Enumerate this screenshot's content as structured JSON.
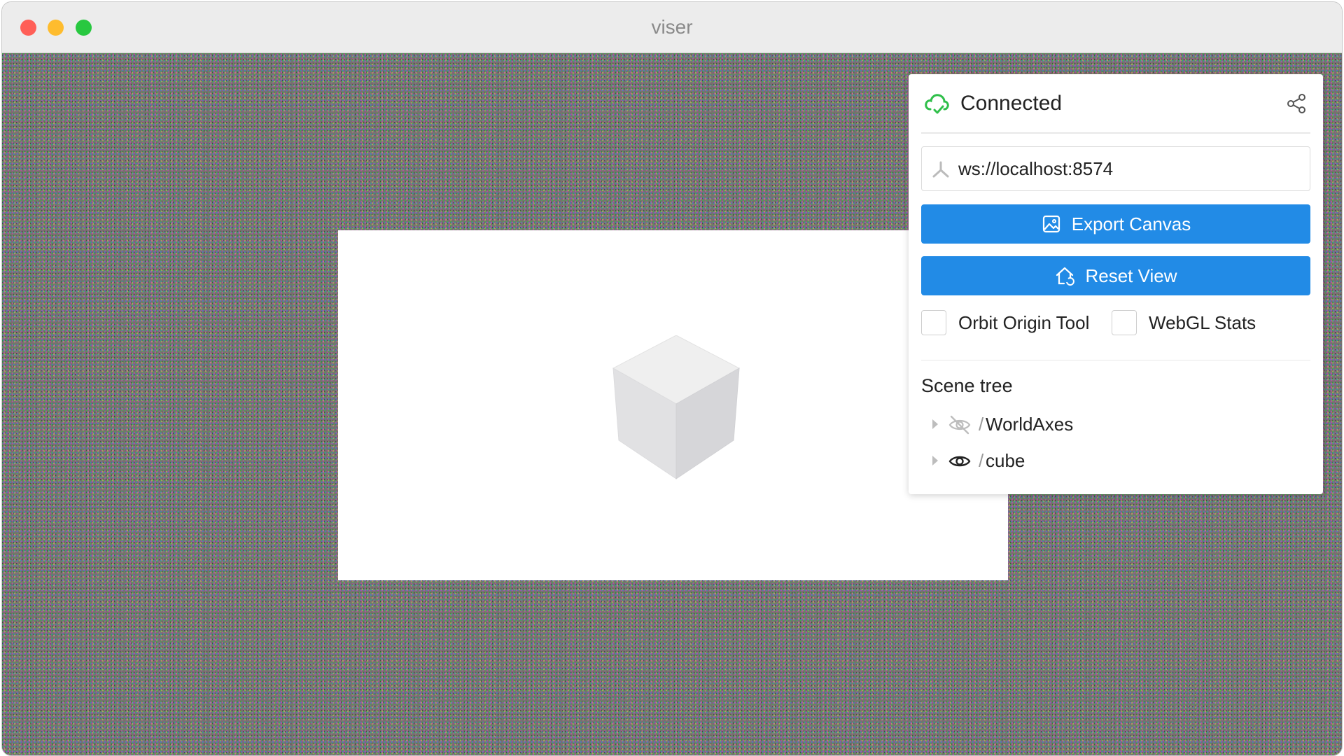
{
  "window": {
    "title": "viser"
  },
  "panel": {
    "status": "Connected",
    "server_url": "ws://localhost:8574",
    "export_button": "Export Canvas",
    "reset_button": "Reset View",
    "checkboxes": [
      {
        "label": "Orbit Origin Tool",
        "checked": false
      },
      {
        "label": "WebGL Stats",
        "checked": false
      }
    ],
    "scene_tree": {
      "title": "Scene tree",
      "items": [
        {
          "prefix": "/",
          "name": "WorldAxes",
          "visible": false,
          "icon": "eye-off-icon"
        },
        {
          "prefix": "/",
          "name": "cube",
          "visible": true,
          "icon": "eye-icon"
        }
      ]
    }
  },
  "colors": {
    "accent": "#228be6",
    "connected": "#2fbf4a"
  }
}
